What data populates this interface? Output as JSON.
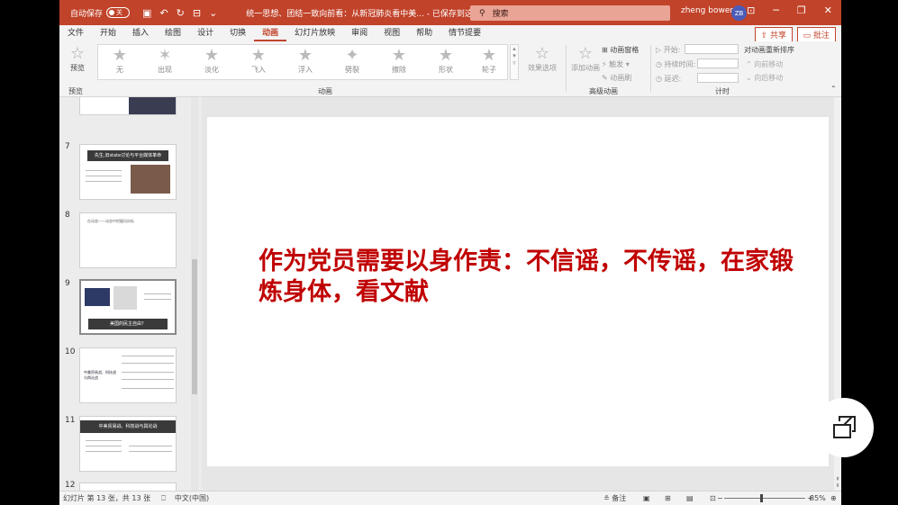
{
  "titlebar": {
    "autosave_label": "自动保存",
    "autosave_state": "关",
    "doc_title": "统一思想、团结一致向前看：从新冠肺炎看中美... - 已保存到这台电脑 ▾",
    "search_placeholder": "搜索",
    "user_name": "zheng bowen",
    "avatar_initials": "ZB"
  },
  "menu": {
    "tabs": [
      "文件",
      "开始",
      "插入",
      "绘图",
      "设计",
      "切换",
      "动画",
      "幻灯片放映",
      "审阅",
      "视图",
      "帮助",
      "情节提要"
    ],
    "share": "共享",
    "comment": "批注"
  },
  "ribbon": {
    "preview": "预览",
    "preview_group": "预览",
    "animations": [
      "无",
      "出现",
      "淡化",
      "飞入",
      "浮入",
      "劈裂",
      "擦除",
      "形状",
      "轮子"
    ],
    "effect_options": "效果选项",
    "animation_group": "动画",
    "add_animation": "添加动画",
    "animation_pane": "动画窗格",
    "trigger": "触发",
    "animation_painter": "动画刷",
    "advanced_group": "高级动画",
    "start": "开始:",
    "duration": "持续时间:",
    "delay": "延迟:",
    "reorder_title": "对动画重新排序",
    "move_earlier": "向前移动",
    "move_later": "向后移动",
    "timing_group": "计时"
  },
  "thumbnails": [
    {
      "num": "7",
      "title": "先生,旧state讨论与平台媒体革命"
    },
    {
      "num": "8",
      "title": "在动态——动态中把握风向标"
    },
    {
      "num": "9",
      "title": "美国的民主自由？"
    },
    {
      "num": "10",
      "title": "中美贸易战、科技战与舆论战"
    },
    {
      "num": "11",
      "title": "中美贸易战、科技战与舆论战"
    },
    {
      "num": "12",
      "title": ""
    }
  ],
  "slide": {
    "text": "作为党员需要以身作责：不信谣，不传谣，在家锻炼身体，看文献"
  },
  "status": {
    "slide_info": "幻灯片 第 13 张，共 13 张",
    "language": "中文(中国)",
    "notes": "备注",
    "zoom": "85%"
  },
  "colors": {
    "accent": "#c1432a",
    "slide_text": "#c00000"
  }
}
